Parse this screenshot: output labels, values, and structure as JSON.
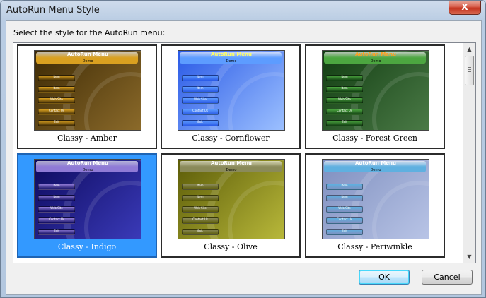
{
  "window": {
    "title": "AutoRun Menu Style",
    "close_label": "X"
  },
  "prompt": "Select the style for the AutoRun menu:",
  "styles": [
    {
      "caption": "Classy - Amber",
      "selected": false,
      "bg1": "#3d2a05",
      "bg2": "#8b6a2a",
      "header": "#d9a020",
      "title_color": "#ffffff"
    },
    {
      "caption": "Classy - Cornflower",
      "selected": false,
      "bg1": "#2a5ae6",
      "bg2": "#9cc0ff",
      "header": "#5d9cff",
      "title_color": "#ffff66"
    },
    {
      "caption": "Classy - Forest Green",
      "selected": false,
      "bg1": "#123d12",
      "bg2": "#4a7a46",
      "header": "#4ca640",
      "title_color": "#ffa020"
    },
    {
      "caption": "Classy - Indigo",
      "selected": true,
      "bg1": "#0d0a5e",
      "bg2": "#3a3ab8",
      "header": "#8f7ad6",
      "title_color": "#ffffff"
    },
    {
      "caption": "Classy - Olive",
      "selected": false,
      "bg1": "#5c5c08",
      "bg2": "#b8b83a",
      "header": "#8a8a5a",
      "title_color": "#ffffff"
    },
    {
      "caption": "Classy - Periwinkle",
      "selected": false,
      "bg1": "#7f8fbf",
      "bg2": "#b8c4e6",
      "header": "#5fb0e0",
      "title_color": "#ffffff"
    }
  ],
  "preview": {
    "menu_title": "AutoRun Menu",
    "menu_sub": "Demo",
    "items": [
      "Item",
      "Item",
      "Web Site",
      "Contact Us",
      "Exit"
    ]
  },
  "buttons": {
    "ok": "OK",
    "cancel": "Cancel"
  }
}
